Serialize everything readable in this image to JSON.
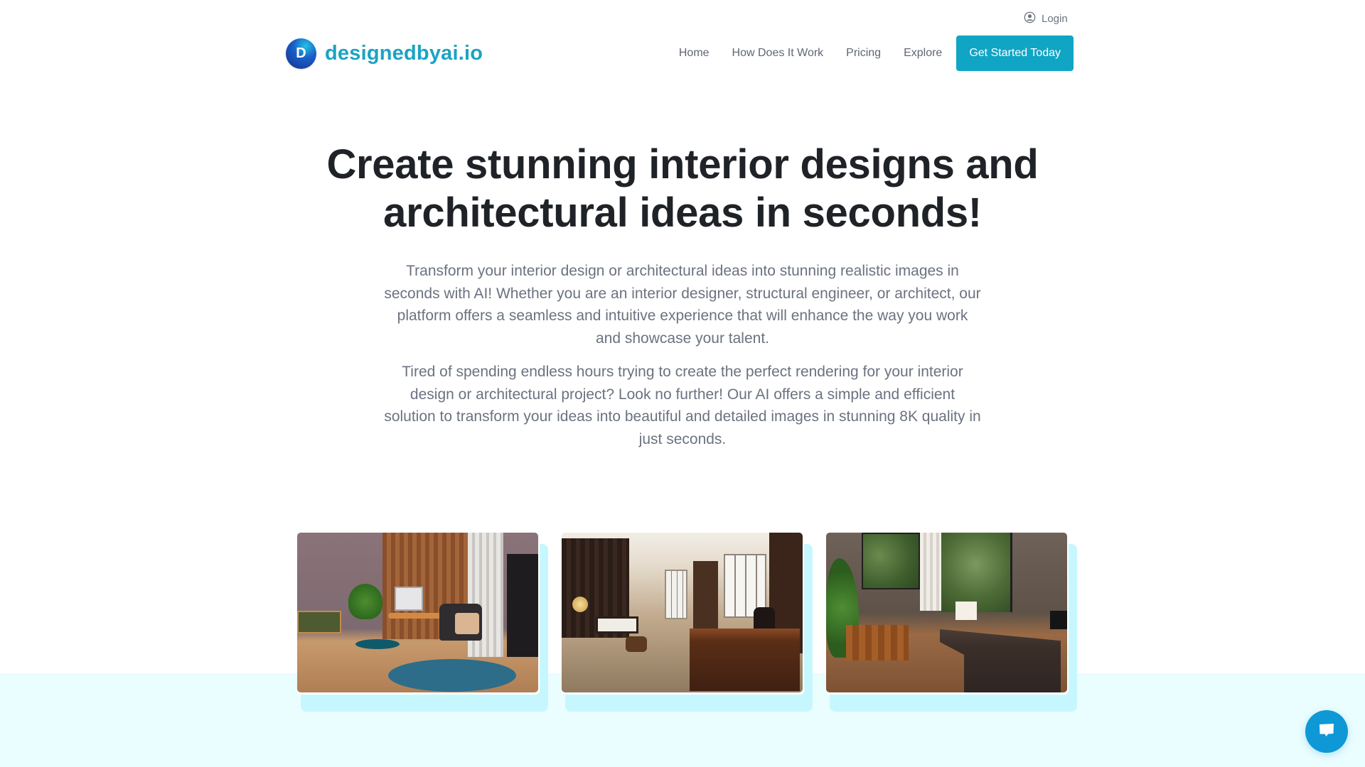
{
  "top_bar": {
    "login_label": "Login",
    "login_icon": "user-circle-icon"
  },
  "header": {
    "brand": {
      "logo_letter": "D",
      "name": "designedbyai.io"
    },
    "nav": [
      {
        "label": "Home"
      },
      {
        "label": "How Does It Work"
      },
      {
        "label": "Pricing"
      },
      {
        "label": "Explore"
      }
    ],
    "cta_label": "Get Started Today"
  },
  "hero": {
    "title_line1": "Create stunning interior designs and",
    "title_line2": "architectural ideas in seconds!",
    "paragraph1": "Transform your interior design or architectural ideas into stunning realistic images in seconds with AI! Whether you are an interior designer, structural engineer, or architect, our platform offers a seamless and intuitive experience that will enhance the way you work and showcase your talent.",
    "paragraph2": "Tired of spending endless hours trying to create the perfect rendering for your interior design or architectural project? Look no further! Our AI offers a simple and efficient solution to transform your ideas into beautiful and detailed images in stunning 8K quality in just seconds."
  },
  "gallery": [
    {
      "alt": "Home office with wood paneling, teal chair and blue rug"
    },
    {
      "alt": "Executive office with dark curtains and wooden desk"
    },
    {
      "alt": "Office with garden windows, wooden credenza and dark desk"
    }
  ],
  "chat_widget": {
    "icon": "chat-bubble-icon"
  },
  "colors": {
    "brand_text": "#1aa3c4",
    "cta_background": "#10a5c4",
    "heading": "#1f2328",
    "body_text": "#6b7280",
    "band_background": "#eafdff",
    "card_shadow": "#c7f7fe",
    "chat_button": "#0e98d6"
  }
}
